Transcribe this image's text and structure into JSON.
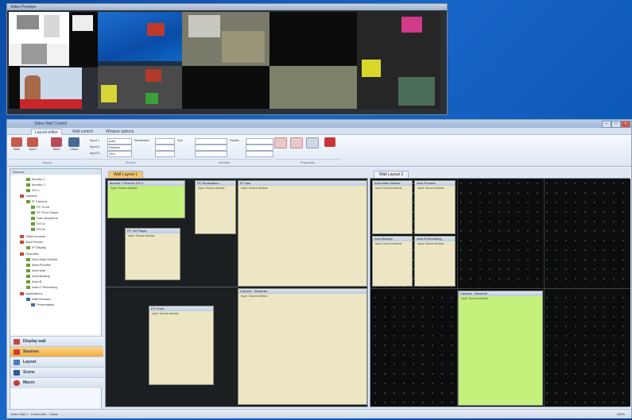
{
  "preview": {
    "title": "Video Preview"
  },
  "app": {
    "title": "Video Wall Control"
  },
  "ribbon_tabs": [
    "Layout editor",
    "Wall control",
    "Window options"
  ],
  "ribbon": {
    "buttons": [
      {
        "label": "New"
      },
      {
        "label": "Open"
      },
      {
        "label": "Save"
      },
      {
        "label": "Close"
      }
    ],
    "fields": [
      {
        "label": "Input 1",
        "value": "Auto"
      },
      {
        "label": "Input 2",
        "value": "Window"
      },
      {
        "label": "Input 3",
        "value": "Grid"
      }
    ],
    "fields2": [
      "Resolution",
      "Fps",
      "Rotate"
    ],
    "group_labels": [
      "Layout",
      "Source",
      "Window",
      "Properties"
    ]
  },
  "sidebar": {
    "header": "Sources",
    "tree": [
      "Monitor 1",
      "Monitor 2",
      "DVI 1",
      "Camera",
      "IP Camera",
      "PC Front",
      "PC Prev Player",
      "Cam Anywhere",
      "DVI-A",
      "DVI-B",
      "Video sources",
      "Input Router",
      "IP Display",
      "Overview",
      "Area Main Monitor",
      "Area Preview",
      "Area Wall",
      "Area Backup",
      "Area B",
      "Area C Recording",
      "Applications",
      "Web Browser",
      "Presentation"
    ],
    "nav": [
      {
        "label": "Display wall",
        "selected": false
      },
      {
        "label": "Sources",
        "selected": true
      },
      {
        "label": "Layout",
        "selected": false
      },
      {
        "label": "Scene",
        "selected": false
      },
      {
        "label": "Macro",
        "selected": false
      }
    ]
  },
  "doc_tabs": [
    {
      "label": "Wall Layout 1",
      "active": true
    },
    {
      "label": "Wall Layout 2",
      "active": false
    }
  ],
  "windows": {
    "pane1": [
      {
        "title": "Monitor 1 Remote DVI 1",
        "body": "Input: Source window",
        "green": true
      },
      {
        "title": "PC Workstation",
        "body": "Input: Source window",
        "green": false
      },
      {
        "title": "IP Cam",
        "body": "Input: Source window",
        "green": false
      },
      {
        "title": "PC Vid Player",
        "body": "Input: Source window",
        "green": false
      },
      {
        "title": "Camera - Streamer",
        "body": "Input: Source window",
        "green": false
      },
      {
        "title": "PC Front",
        "body": "Input: Source window",
        "green": false
      }
    ],
    "pane2": [
      {
        "title": "Area Main Monitor",
        "body": "Input: Source window",
        "green": false
      },
      {
        "title": "Area Preview",
        "body": "Input: Source window",
        "green": false
      },
      {
        "title": "Area Backup",
        "body": "Input: Source window",
        "green": false
      },
      {
        "title": "Area B Recording",
        "body": "Input: Source window",
        "green": false
      },
      {
        "title": "Camera - Streamer",
        "body": "Input: Source window",
        "green": true
      }
    ]
  },
  "status": {
    "text": "Video Wall 1 - Connected - Online",
    "right": "100%"
  }
}
